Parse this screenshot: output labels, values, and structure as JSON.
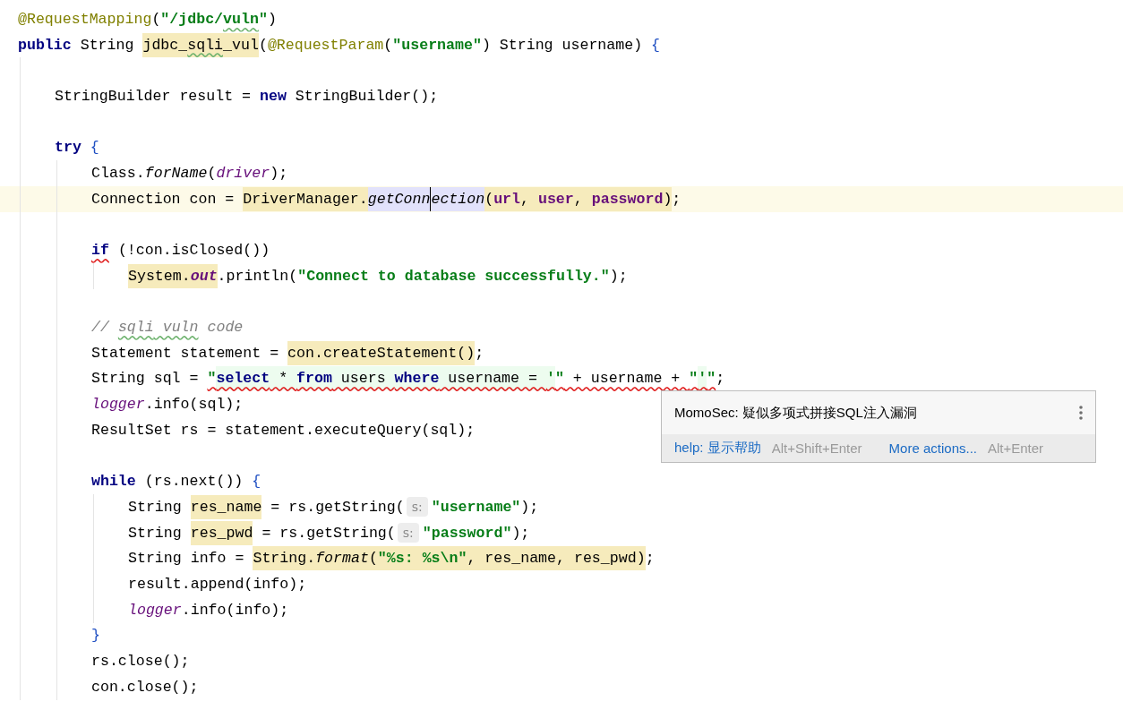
{
  "editor": {
    "lines": [
      {
        "kind": "code",
        "current": false,
        "tokens": [
          {
            "text": "@RequestMapping",
            "kind": "ann"
          },
          {
            "text": "(",
            "kind": "plain"
          },
          {
            "text": "\"/jdbc/",
            "kind": "str"
          },
          {
            "text": "vuln",
            "kind": "str",
            "typo": true
          },
          {
            "text": "\"",
            "kind": "str"
          },
          {
            "text": ")",
            "kind": "plain"
          }
        ]
      },
      {
        "kind": "code",
        "current": false,
        "tokens": [
          {
            "text": "public",
            "kind": "kw"
          },
          {
            "text": " String ",
            "kind": "plain"
          },
          {
            "text": "jdbc_",
            "kind": "plain",
            "usage": true
          },
          {
            "text": "sqli",
            "kind": "plain",
            "usage": true,
            "typo": true
          },
          {
            "text": "_vul",
            "kind": "plain",
            "usage": true
          },
          {
            "text": "(",
            "kind": "plain"
          },
          {
            "text": "@RequestParam",
            "kind": "ann"
          },
          {
            "text": "(",
            "kind": "plain"
          },
          {
            "text": "\"username\"",
            "kind": "str"
          },
          {
            "text": ") String username) ",
            "kind": "plain"
          },
          {
            "text": "{",
            "kind": "brace"
          }
        ],
        "children": [
          {
            "kind": "blank"
          },
          {
            "kind": "code",
            "current": false,
            "tokens": [
              {
                "text": "StringBuilder result = ",
                "kind": "plain"
              },
              {
                "text": "new",
                "kind": "kw"
              },
              {
                "text": " StringBuilder();",
                "kind": "plain"
              }
            ]
          },
          {
            "kind": "blank"
          },
          {
            "kind": "code",
            "current": false,
            "tokens": [
              {
                "text": "try",
                "kind": "kw"
              },
              {
                "text": " {",
                "kind": "brace"
              }
            ],
            "children": [
              {
                "kind": "code",
                "current": false,
                "tokens": [
                  {
                    "text": "Class.",
                    "kind": "plain"
                  },
                  {
                    "text": "forName",
                    "kind": "method"
                  },
                  {
                    "text": "(",
                    "kind": "plain"
                  },
                  {
                    "text": "driver",
                    "kind": "var"
                  },
                  {
                    "text": ");",
                    "kind": "plain"
                  }
                ]
              },
              {
                "kind": "code",
                "current": true,
                "tokens": [
                  {
                    "text": "Connection con = ",
                    "kind": "plain"
                  },
                  {
                    "text": "DriverManager.",
                    "kind": "plain",
                    "usage": true
                  },
                  {
                    "text": "getConn",
                    "kind": "method",
                    "ref": true,
                    "caret": true
                  },
                  {
                    "text": "ection",
                    "kind": "method",
                    "ref": true
                  },
                  {
                    "text": "(",
                    "kind": "plain",
                    "usage": true
                  },
                  {
                    "text": "url",
                    "kind": "field",
                    "usage": true
                  },
                  {
                    "text": ", ",
                    "kind": "plain",
                    "usage": true
                  },
                  {
                    "text": "user",
                    "kind": "field",
                    "usage": true
                  },
                  {
                    "text": ", ",
                    "kind": "plain",
                    "usage": true
                  },
                  {
                    "text": "password",
                    "kind": "field",
                    "usage": true
                  },
                  {
                    "text": ")",
                    "kind": "plain",
                    "usage": true
                  },
                  {
                    "text": ";",
                    "kind": "plain"
                  }
                ]
              },
              {
                "kind": "blank"
              },
              {
                "kind": "code",
                "current": false,
                "tokens": [
                  {
                    "text": "if",
                    "kind": "kw",
                    "error": true
                  },
                  {
                    "text": " (!con.isClosed())",
                    "kind": "plain"
                  }
                ],
                "children": [
                  {
                    "kind": "code",
                    "current": false,
                    "tokens": [
                      {
                        "text": "System.",
                        "kind": "plain",
                        "usage": true
                      },
                      {
                        "text": "out",
                        "kind": "static",
                        "usage": true
                      },
                      {
                        "text": ".println(",
                        "kind": "plain"
                      },
                      {
                        "text": "\"Connect to database successfully.\"",
                        "kind": "str"
                      },
                      {
                        "text": ");",
                        "kind": "plain"
                      }
                    ]
                  }
                ]
              },
              {
                "kind": "blank"
              },
              {
                "kind": "code",
                "current": false,
                "tokens": [
                  {
                    "text": "// ",
                    "kind": "comment"
                  },
                  {
                    "text": "sqli",
                    "kind": "comment",
                    "typo": true
                  },
                  {
                    "text": " vuln",
                    "kind": "comment",
                    "typo": true
                  },
                  {
                    "text": " code",
                    "kind": "comment"
                  }
                ]
              },
              {
                "kind": "code",
                "current": false,
                "tokens": [
                  {
                    "text": "Statement statement = ",
                    "kind": "plain"
                  },
                  {
                    "text": "con.createStatement()",
                    "kind": "plain",
                    "usage": true
                  },
                  {
                    "text": ";",
                    "kind": "plain"
                  }
                ]
              },
              {
                "kind": "code",
                "current": false,
                "tokens": [
                  {
                    "text": "String sql = ",
                    "kind": "plain"
                  },
                  {
                    "text": "\"",
                    "kind": "str",
                    "error": true
                  },
                  {
                    "text": "select",
                    "kind": "kw",
                    "inject": true,
                    "error": true
                  },
                  {
                    "text": " * ",
                    "kind": "plain",
                    "inject": true,
                    "error": true
                  },
                  {
                    "text": "from",
                    "kind": "kw",
                    "inject": true,
                    "error": true
                  },
                  {
                    "text": " users ",
                    "kind": "plain",
                    "inject": true,
                    "error": true
                  },
                  {
                    "text": "where",
                    "kind": "kw",
                    "inject": true,
                    "error": true
                  },
                  {
                    "text": " username = ",
                    "kind": "plain",
                    "inject": true,
                    "error": true
                  },
                  {
                    "text": "'",
                    "kind": "str",
                    "inject": true,
                    "error": true
                  },
                  {
                    "text": "\"",
                    "kind": "str",
                    "error": true
                  },
                  {
                    "text": " + username + ",
                    "kind": "plain",
                    "error": true
                  },
                  {
                    "text": "\"",
                    "kind": "str",
                    "error": true
                  },
                  {
                    "text": "'",
                    "kind": "str",
                    "inject": true,
                    "error": true
                  },
                  {
                    "text": "\"",
                    "kind": "str",
                    "error": true
                  },
                  {
                    "text": ";",
                    "kind": "plain"
                  }
                ]
              },
              {
                "kind": "code",
                "current": false,
                "tokens": [
                  {
                    "text": "logger",
                    "kind": "var"
                  },
                  {
                    "text": ".info(sql);",
                    "kind": "plain"
                  }
                ]
              },
              {
                "kind": "code",
                "current": false,
                "tokens": [
                  {
                    "text": "ResultSet rs = statement.executeQuery(sql);",
                    "kind": "plain"
                  }
                ]
              },
              {
                "kind": "blank"
              },
              {
                "kind": "code",
                "current": false,
                "tokens": [
                  {
                    "text": "while",
                    "kind": "kw"
                  },
                  {
                    "text": " (rs.next()) ",
                    "kind": "plain"
                  },
                  {
                    "text": "{",
                    "kind": "brace"
                  }
                ],
                "children": [
                  {
                    "kind": "code",
                    "current": false,
                    "tokens": [
                      {
                        "text": "String ",
                        "kind": "plain"
                      },
                      {
                        "text": "res_name",
                        "kind": "plain",
                        "usage": true
                      },
                      {
                        "text": " = rs.getString(",
                        "kind": "plain"
                      },
                      {
                        "text": "s:",
                        "kind": "hint"
                      },
                      {
                        "text": "\"username\"",
                        "kind": "str"
                      },
                      {
                        "text": ");",
                        "kind": "plain"
                      }
                    ]
                  },
                  {
                    "kind": "code",
                    "current": false,
                    "tokens": [
                      {
                        "text": "String ",
                        "kind": "plain"
                      },
                      {
                        "text": "res_pwd",
                        "kind": "plain",
                        "usage": true
                      },
                      {
                        "text": " = rs.getString(",
                        "kind": "plain"
                      },
                      {
                        "text": "s:",
                        "kind": "hint"
                      },
                      {
                        "text": "\"password\"",
                        "kind": "str"
                      },
                      {
                        "text": ");",
                        "kind": "plain"
                      }
                    ]
                  },
                  {
                    "kind": "code",
                    "current": false,
                    "tokens": [
                      {
                        "text": "String info = ",
                        "kind": "plain"
                      },
                      {
                        "text": "String.",
                        "kind": "plain",
                        "usage": true
                      },
                      {
                        "text": "format",
                        "kind": "method",
                        "usage": true
                      },
                      {
                        "text": "(",
                        "kind": "plain",
                        "usage": true
                      },
                      {
                        "text": "\"%s: %s\\n\"",
                        "kind": "str",
                        "usage": true
                      },
                      {
                        "text": ", res_name, res_pwd)",
                        "kind": "plain",
                        "usage": true
                      },
                      {
                        "text": ";",
                        "kind": "plain"
                      }
                    ]
                  },
                  {
                    "kind": "code",
                    "current": false,
                    "tokens": [
                      {
                        "text": "result.append(info);",
                        "kind": "plain"
                      }
                    ]
                  },
                  {
                    "kind": "code",
                    "current": false,
                    "tokens": [
                      {
                        "text": "logger",
                        "kind": "var"
                      },
                      {
                        "text": ".info(info);",
                        "kind": "plain"
                      }
                    ]
                  }
                ]
              },
              {
                "kind": "code",
                "current": false,
                "tokens": [
                  {
                    "text": "}",
                    "kind": "brace"
                  }
                ]
              },
              {
                "kind": "code",
                "current": false,
                "tokens": [
                  {
                    "text": "rs.close();",
                    "kind": "plain"
                  }
                ]
              },
              {
                "kind": "code",
                "current": false,
                "tokens": [
                  {
                    "text": "con.close();",
                    "kind": "plain"
                  }
                ]
              }
            ]
          }
        ]
      }
    ]
  },
  "popup": {
    "title": "MomoSec: 疑似多项式拼接SQL注入漏洞",
    "actions": [
      {
        "label": "help: 显示帮助",
        "shortcut": "Alt+Shift+Enter"
      },
      {
        "label": "More actions...",
        "shortcut": "Alt+Enter"
      }
    ]
  }
}
